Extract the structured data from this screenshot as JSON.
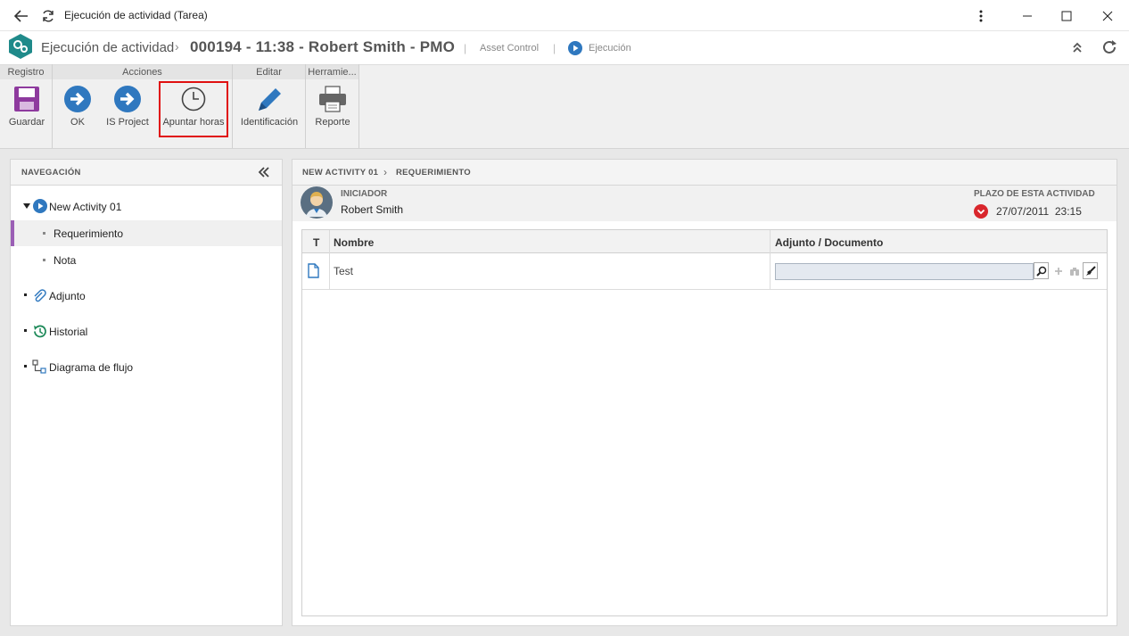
{
  "window": {
    "title": "Ejecución de actividad (Tarea)"
  },
  "header": {
    "module": "Ejecución de actividad",
    "record": "000194 - 11:38 - Robert Smith - PMO",
    "process": "Asset Control",
    "status": "Ejecución"
  },
  "ribbon": {
    "groups": {
      "registro": "Registro",
      "acciones": "Acciones",
      "editar": "Editar",
      "herramientas": "Herramie..."
    },
    "buttons": {
      "guardar": "Guardar",
      "ok": "OK",
      "is_project": "IS Project",
      "apuntar_horas": "Apuntar horas",
      "identificacion": "Identificación",
      "reporte": "Reporte"
    }
  },
  "nav": {
    "title": "NAVEGACIÓN",
    "activity": "New Activity 01",
    "requerimiento": "Requerimiento",
    "nota": "Nota",
    "adjunto": "Adjunto",
    "historial": "Historial",
    "diagrama": "Diagrama de flujo"
  },
  "content": {
    "breadcrumb_1": "NEW ACTIVITY 01",
    "breadcrumb_2": "REQUERIMIENTO",
    "iniciador_label": "INICIADOR",
    "iniciador_name": "Robert Smith",
    "plazo_label": "PLAZO DE ESTA ACTIVIDAD",
    "plazo_date": "27/07/2011",
    "plazo_time": "23:15"
  },
  "table": {
    "columns": [
      "T",
      "Nombre",
      "Adjunto / Documento"
    ],
    "rows": [
      {
        "name": "Test",
        "document": ""
      }
    ]
  },
  "colors": {
    "accent": "#2f78bf",
    "highlight": "#e01010",
    "nav_selected": "#9b5fb5",
    "logo": "#1f8a8a",
    "save": "#8e3a9e"
  }
}
